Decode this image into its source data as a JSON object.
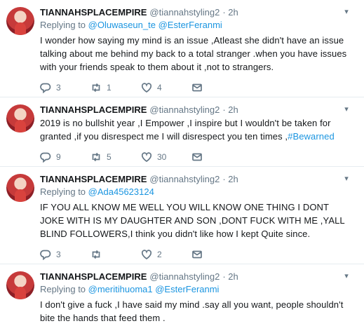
{
  "tweets": [
    {
      "name": "TIANNAHSPLACEMPIRE",
      "handle": "@tiannahstyling2",
      "time": "· 2h",
      "replying_prefix": "Replying to ",
      "replying_to": [
        "@Oluwaseun_te",
        "@EsterFeranmi"
      ],
      "text": "I wonder how saying my mind is an issue ,Atleast she didn't have an issue talking about me behind my back to a total stranger .when you have issues with your friends speak to them about it ,not to strangers.",
      "hashtag": "",
      "replies": "3",
      "retweets": "1",
      "likes": "4"
    },
    {
      "name": "TIANNAHSPLACEMPIRE",
      "handle": "@tiannahstyling2",
      "time": "· 2h",
      "replying_prefix": "",
      "replying_to": [],
      "text": "2019 is no bullshit year ,I Empower ,I inspire but I wouldn't be taken for granted ,if you disrespect me I will disrespect you ten times ,",
      "hashtag": "#Bewarned",
      "replies": "9",
      "retweets": "5",
      "likes": "30"
    },
    {
      "name": "TIANNAHSPLACEMPIRE",
      "handle": "@tiannahstyling2",
      "time": "· 2h",
      "replying_prefix": "Replying to ",
      "replying_to": [
        "@Ada45623124"
      ],
      "text": "IF YOU ALL KNOW ME WELL YOU WILL KNOW ONE THING I DONT JOKE WITH IS MY DAUGHTER AND SON ,DONT FUCK WITH ME ,YALL BLIND FOLLOWERS,I think you didn't like how I kept Quite since.",
      "hashtag": "",
      "replies": "3",
      "retweets": "",
      "likes": "2"
    },
    {
      "name": "TIANNAHSPLACEMPIRE",
      "handle": "@tiannahstyling2",
      "time": "· 2h",
      "replying_prefix": "Replying to ",
      "replying_to": [
        "@meritihuoma1",
        "@EsterFeranmi"
      ],
      "text": "I don't give a fuck ,I have said my mind .say all you want, people shouldn't bite the hands that feed them .",
      "hashtag": "",
      "replies": "",
      "retweets": "",
      "likes": ""
    }
  ],
  "icons": {
    "reply": "reply-icon",
    "retweet": "retweet-icon",
    "like": "heart-icon",
    "dm": "envelope-icon",
    "caret": "chevron-down-icon"
  },
  "colors": {
    "link": "#1b95e0",
    "secondary": "#657786",
    "divider": "#e6ecf0"
  }
}
